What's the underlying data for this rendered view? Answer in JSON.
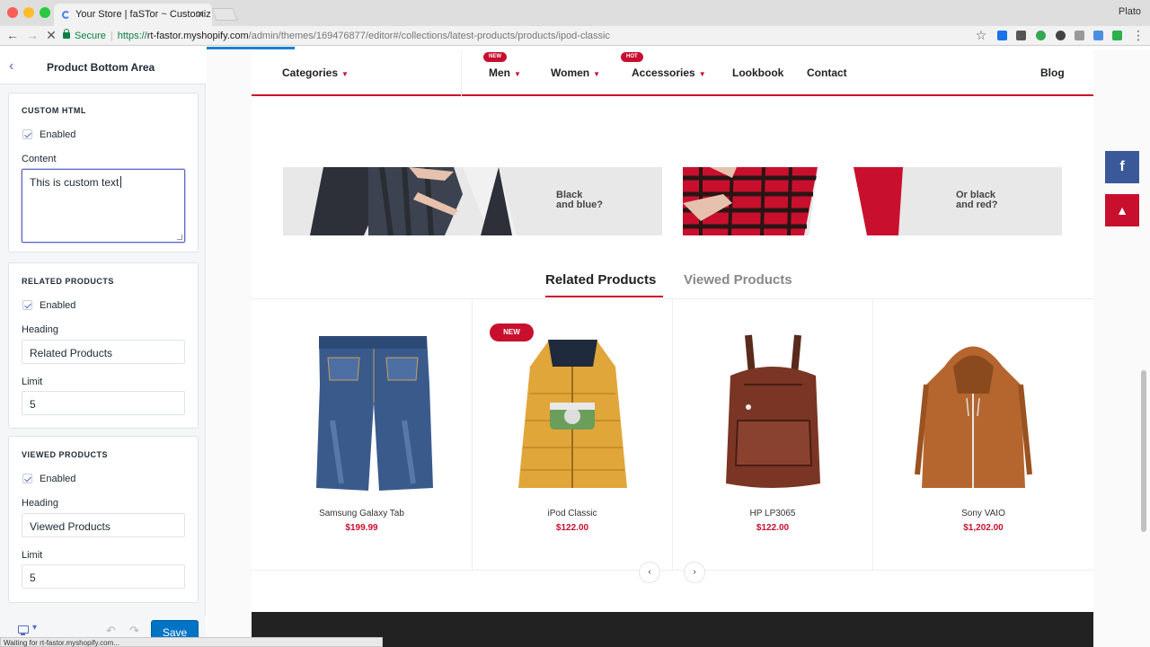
{
  "browser": {
    "tab_title": "Your Store | faSTor ~ Customiz",
    "profile": "Plato",
    "secure_label": "Secure",
    "url_scheme": "https://",
    "url_host": "rt-fastor.myshopify.com",
    "url_path": "/admin/themes/169476877/editor#/collections/latest-products/products/ipod-classic",
    "status_text": "Waiting for rt-fastor.myshopify.com..."
  },
  "panel": {
    "title": "Product Bottom Area",
    "custom_html": {
      "title": "CUSTOM HTML",
      "enabled_label": "Enabled",
      "content_label": "Content",
      "content_value": "This is custom text"
    },
    "related": {
      "title": "RELATED PRODUCTS",
      "enabled_label": "Enabled",
      "heading_label": "Heading",
      "heading_value": "Related Products",
      "limit_label": "Limit",
      "limit_value": "5"
    },
    "viewed": {
      "title": "VIEWED PRODUCTS",
      "enabled_label": "Enabled",
      "heading_label": "Heading",
      "heading_value": "Viewed Products",
      "limit_label": "Limit",
      "limit_value": "5"
    },
    "save_label": "Save"
  },
  "store": {
    "menu": {
      "categories": "Categories",
      "men": "Men",
      "men_badge": "NEW",
      "women": "Women",
      "accessories": "Accessories",
      "accessories_badge": "HOT",
      "lookbook": "Lookbook",
      "contact": "Contact",
      "blog": "Blog"
    },
    "banners": [
      {
        "text": "Black\nand blue?"
      },
      {
        "text": "Or  black\nand red?"
      }
    ],
    "tabs": {
      "related": "Related Products",
      "viewed": "Viewed Products"
    },
    "products": [
      {
        "name": "Samsung Galaxy Tab",
        "price": "$199.99"
      },
      {
        "name": "iPod Classic",
        "price": "$122.00",
        "badge": "NEW"
      },
      {
        "name": "HP LP3065",
        "price": "$122.00"
      },
      {
        "name": "Sony VAIO",
        "price": "$1,202.00"
      }
    ]
  },
  "colors": {
    "accent": "#c8102e",
    "save_button": "#0073c4",
    "facebook": "#3b5998"
  }
}
